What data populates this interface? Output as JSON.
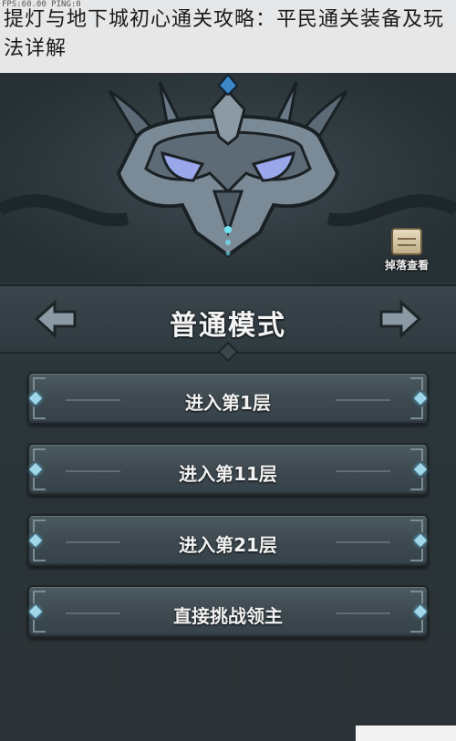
{
  "overlay": {
    "fps_text": "FPS:60.00 PING:0",
    "caption": "提灯与地下城初心通关攻略：平民通关装备及玩法详解"
  },
  "boss_panel": {
    "emblem_icon": "horned-demon-helmet-emblem",
    "loot_button": {
      "icon": "scroll-icon",
      "label": "掉落查看"
    }
  },
  "mode_selector": {
    "title": "普通模式",
    "prev_icon": "left-arrow-icon",
    "next_icon": "right-arrow-icon"
  },
  "floor_buttons": [
    {
      "label": "进入第1层"
    },
    {
      "label": "进入第11层"
    },
    {
      "label": "进入第21层"
    },
    {
      "label": "直接挑战领主"
    }
  ],
  "colors": {
    "background": "#2b3438",
    "button_fill": "#3e4a50",
    "gem_glow": "#9fd6ea",
    "text": "#f2f2f2"
  }
}
